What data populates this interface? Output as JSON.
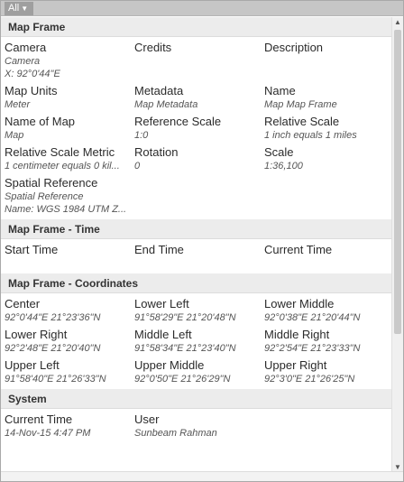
{
  "filter": {
    "label": "All"
  },
  "sections": [
    {
      "title": "Map Frame",
      "rows": [
        [
          {
            "label": "Camera",
            "values": [
              "Camera",
              "X: 92°0'44\"E"
            ]
          },
          {
            "label": "Credits",
            "values": []
          },
          {
            "label": "Description",
            "values": []
          }
        ],
        [
          {
            "label": "Map Units",
            "values": [
              "Meter"
            ]
          },
          {
            "label": "Metadata",
            "values": [
              "Map Metadata"
            ]
          },
          {
            "label": "Name",
            "values": [
              "Map Map Frame"
            ]
          }
        ],
        [
          {
            "label": "Name of Map",
            "values": [
              "Map"
            ]
          },
          {
            "label": "Reference Scale",
            "values": [
              "1:0"
            ]
          },
          {
            "label": "Relative Scale",
            "values": [
              "1 inch equals  1 miles"
            ]
          }
        ],
        [
          {
            "label": "Relative Scale Metric",
            "values": [
              "1 centimeter equals 0 kil..."
            ]
          },
          {
            "label": "Rotation",
            "values": [
              "0"
            ]
          },
          {
            "label": "Scale",
            "values": [
              "1:36,100"
            ]
          }
        ],
        [
          {
            "label": "Spatial Reference",
            "values": [
              "Spatial Reference",
              "Name: WGS 1984 UTM Z..."
            ]
          }
        ]
      ]
    },
    {
      "title": "Map Frame - Time",
      "rows": [
        [
          {
            "label": "Start Time",
            "values": []
          },
          {
            "label": "End Time",
            "values": []
          },
          {
            "label": "Current Time",
            "values": []
          }
        ]
      ]
    },
    {
      "title": "Map Frame - Coordinates",
      "rows": [
        [
          {
            "label": "Center",
            "values": [
              "92°0'44\"E 21°23'36\"N"
            ]
          },
          {
            "label": "Lower Left",
            "values": [
              "91°58'29\"E 21°20'48\"N"
            ]
          },
          {
            "label": "Lower Middle",
            "values": [
              "92°0'38\"E 21°20'44\"N"
            ]
          }
        ],
        [
          {
            "label": "Lower Right",
            "values": [
              "92°2'48\"E 21°20'40\"N"
            ]
          },
          {
            "label": "Middle Left",
            "values": [
              "91°58'34\"E 21°23'40\"N"
            ]
          },
          {
            "label": "Middle Right",
            "values": [
              "92°2'54\"E 21°23'33\"N"
            ]
          }
        ],
        [
          {
            "label": "Upper Left",
            "values": [
              "91°58'40\"E 21°26'33\"N"
            ]
          },
          {
            "label": "Upper Middle",
            "values": [
              "92°0'50\"E 21°26'29\"N"
            ]
          },
          {
            "label": "Upper Right",
            "values": [
              "92°3'0\"E 21°26'25\"N"
            ]
          }
        ]
      ]
    },
    {
      "title": "System",
      "rows": [
        [
          {
            "label": "Current Time",
            "values": [
              "14-Nov-15 4:47 PM"
            ]
          },
          {
            "label": "User",
            "values": [
              "Sunbeam Rahman"
            ]
          }
        ]
      ]
    }
  ],
  "icons": {
    "dropdown": "chevron-down-icon",
    "scroll_up": "arrow-up-icon",
    "scroll_down": "arrow-down-icon"
  }
}
